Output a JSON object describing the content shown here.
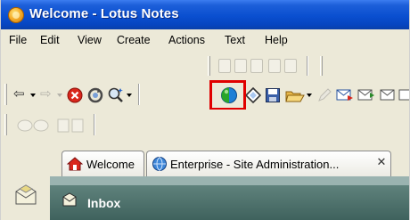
{
  "window": {
    "title": "Welcome - Lotus Notes"
  },
  "menu": [
    "File",
    "Edit",
    "View",
    "Create",
    "Actions",
    "Text",
    "Help"
  ],
  "tabs": [
    {
      "label": "Welcome"
    },
    {
      "label": "Enterprise - Site Administration..."
    }
  ],
  "content": {
    "section_label": "Inbox"
  },
  "colors": {
    "highlight": "#e00000",
    "titlebar": "#0a4fd0",
    "content": "#4a6f6a"
  }
}
